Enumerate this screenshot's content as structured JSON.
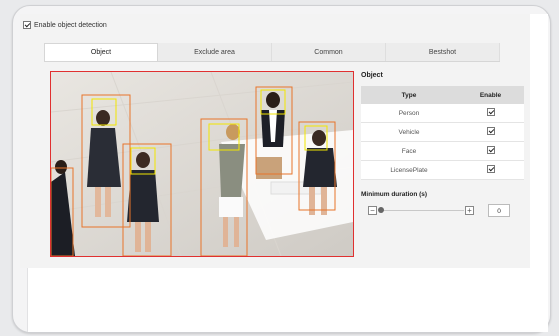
{
  "detection": {
    "enable_label": "Enable object detection",
    "enabled": true
  },
  "tabs": [
    {
      "label": "Object",
      "active": true
    },
    {
      "label": "Exclude area",
      "active": false
    },
    {
      "label": "Common",
      "active": false
    },
    {
      "label": "Bestshot",
      "active": false
    }
  ],
  "object_section": {
    "title": "Object",
    "headers": {
      "type": "Type",
      "enable": "Enable"
    },
    "rows": [
      {
        "type": "Person",
        "enabled": true
      },
      {
        "type": "Vehicle",
        "enabled": true
      },
      {
        "type": "Face",
        "enabled": true
      },
      {
        "type": "LicensePlate",
        "enabled": true
      }
    ]
  },
  "min_duration": {
    "title": "Minimum duration (s)",
    "value": "0",
    "slider_fraction": 0
  },
  "colors": {
    "detect_person": "#e8742a",
    "detect_face": "#f2e600",
    "viewport_border": "#e03030"
  }
}
